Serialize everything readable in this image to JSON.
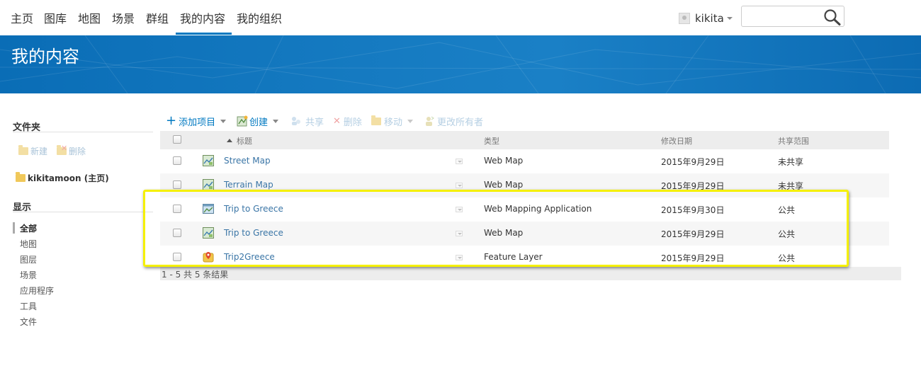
{
  "nav": {
    "items": [
      "主页",
      "图库",
      "地图",
      "场景",
      "群组",
      "我的内容",
      "我的组织"
    ],
    "active": "我的内容"
  },
  "user": {
    "name": "kikita"
  },
  "search": {
    "placeholder": ""
  },
  "banner": {
    "title": "我的内容"
  },
  "sidebar": {
    "folders_heading": "文件夹",
    "new_label": "新建",
    "delete_label": "删除",
    "folder_name": "kikitamoon (主页)",
    "show_heading": "显示",
    "show_items": [
      "全部",
      "地图",
      "图层",
      "场景",
      "应用程序",
      "工具",
      "文件"
    ],
    "show_active": "全部"
  },
  "toolbar": {
    "add_item": "添加项目",
    "create": "创建",
    "share": "共享",
    "delete": "删除",
    "move": "移动",
    "change_owner": "更改所有者"
  },
  "table": {
    "headers": {
      "title": "标题",
      "type": "类型",
      "modified": "修改日期",
      "sharing": "共享范围"
    },
    "rows": [
      {
        "title": "Street Map",
        "type": "Web Map",
        "modified": "2015年9月29日",
        "sharing": "未共享",
        "icon": "web-map-icon"
      },
      {
        "title": "Terrain Map",
        "type": "Web Map",
        "modified": "2015年9月29日",
        "sharing": "未共享",
        "icon": "web-map-icon"
      },
      {
        "title": "Trip to Greece",
        "type": "Web Mapping Application",
        "modified": "2015年9月30日",
        "sharing": "公共",
        "icon": "web-app-icon"
      },
      {
        "title": "Trip to Greece",
        "type": "Web Map",
        "modified": "2015年9月29日",
        "sharing": "公共",
        "icon": "web-map-icon"
      },
      {
        "title": "Trip2Greece",
        "type": "Feature Layer",
        "modified": "2015年9月29日",
        "sharing": "公共",
        "icon": "feature-layer-icon"
      }
    ],
    "footer": "1 - 5 共 5 条结果"
  },
  "colors": {
    "brand": "#0079c1",
    "highlight": "#f5f000"
  }
}
